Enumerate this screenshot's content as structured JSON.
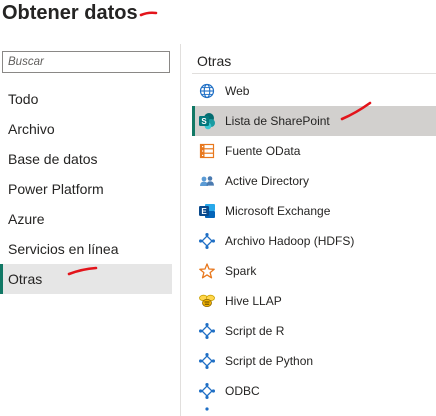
{
  "header": {
    "title": "Obtener datos"
  },
  "search": {
    "placeholder": "Buscar",
    "value": ""
  },
  "categories": [
    {
      "label": "Todo"
    },
    {
      "label": "Archivo"
    },
    {
      "label": "Base de datos"
    },
    {
      "label": "Power Platform"
    },
    {
      "label": "Azure"
    },
    {
      "label": "Servicios en línea"
    },
    {
      "label": "Otras",
      "selected": true
    }
  ],
  "section": {
    "title": "Otras"
  },
  "sources": [
    {
      "label": "Web",
      "icon": "globe-icon"
    },
    {
      "label": "Lista de SharePoint",
      "icon": "sharepoint-icon",
      "selected": true
    },
    {
      "label": "Fuente OData",
      "icon": "odata-icon"
    },
    {
      "label": "Active Directory",
      "icon": "active-directory-icon"
    },
    {
      "label": "Microsoft Exchange",
      "icon": "exchange-icon"
    },
    {
      "label": "Archivo Hadoop (HDFS)",
      "icon": "connector-icon"
    },
    {
      "label": "Spark",
      "icon": "spark-star-icon"
    },
    {
      "label": "Hive LLAP",
      "icon": "hive-bee-icon"
    },
    {
      "label": "Script de R",
      "icon": "connector-icon"
    },
    {
      "label": "Script de Python",
      "icon": "connector-icon"
    },
    {
      "label": "ODBC",
      "icon": "connector-icon"
    }
  ],
  "colors": {
    "accent": "#117865",
    "annotation": "#e3141b",
    "connector": "#1f6fc5"
  }
}
